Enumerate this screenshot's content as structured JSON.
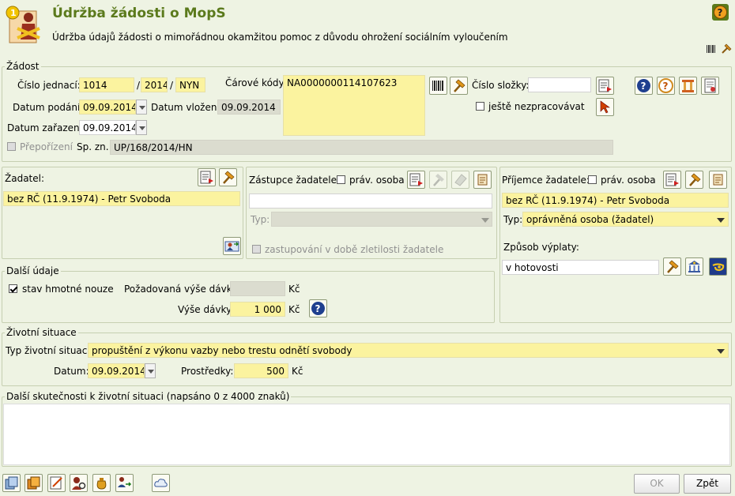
{
  "header": {
    "title": "Údržba žádosti o MopS",
    "subtitle": "Údržba údajů žádosti o mimořádnou okamžitou pomoc z důvodu ohrožení sociálním vyloučením",
    "help_icon": "help-icon",
    "tool_icons": [
      "barcode-icon",
      "hammer-icon"
    ]
  },
  "zadost": {
    "legend": "Žádost",
    "cislo_jednaci_label": "Číslo jednací:",
    "cj_1": "1014",
    "sep1": "/",
    "cj_2": "2014",
    "sep2": "/",
    "cj_3": "NYN",
    "carove_kody_label": "Čárové kódy:",
    "carove_kody_value": "NA0000000114107623",
    "cislo_slozky_label": "Číslo složky:",
    "cislo_slozky_value": "",
    "jeste_nezpracovavat_label": "ještě nezpracovávat",
    "datum_podani_label": "Datum podání:",
    "datum_podani": "09.09.2014",
    "datum_vlozeni_label": "Datum vložení:",
    "datum_vlozeni": "09.09.2014",
    "datum_zarazeni_label": "Datum zařazení:",
    "datum_zarazeni": "09.09.2014",
    "prepotizeni_label": "Přepořízení",
    "sp_zn_label": "Sp. zn.:",
    "sp_zn": "UP/168/2014/HN"
  },
  "zadatel": {
    "label": "Žadatel:",
    "value": "bez RČ (11.9.1974) - Petr Svoboda"
  },
  "zastupce": {
    "label": "Zástupce žadatele:",
    "prav_osoba": "práv. osoba",
    "value": "",
    "typ_label": "Typ:",
    "typ_value": "",
    "zletilost_label": "zastupování v době zletilosti žadatele"
  },
  "prijemce": {
    "label": "Příjemce žadatele:",
    "prav_osoba": "práv. osoba",
    "value": "bez RČ (11.9.1974) - Petr Svoboda",
    "typ_label": "Typ:",
    "typ_value": "oprávněná osoba (žadatel)",
    "zpusob_label": "Způsob výplaty:",
    "zpusob_value": "v hotovosti"
  },
  "dalsi": {
    "legend": "Další údaje",
    "hmotna_nouze": "stav hmotné nouze",
    "pozadovana_label": "Požadovaná výše dávky:",
    "pozadovana_value": "",
    "kc1": "Kč",
    "vyse_label": "Výše dávky:",
    "vyse_value": "1 000",
    "kc2": "Kč"
  },
  "zivotni": {
    "legend": "Životní situace",
    "typ_label": "Typ životní situace:",
    "typ_value": "propuštění z výkonu vazby nebo trestu odnětí svobody",
    "datum_label": "Datum:",
    "datum_value": "09.09.2014",
    "prostredky_label": "Prostředky:",
    "prostredky_value": "500",
    "kc": "Kč"
  },
  "skutecnosti": {
    "legend": "Další skutečnosti k životní situaci (napsáno 0 z 4000 znaků)",
    "value": ""
  },
  "footer": {
    "ok": "OK",
    "zpet": "Zpět"
  },
  "colors": {
    "accent": "#5b7a1c",
    "field": "#fbf39f",
    "background": "#eef3e3"
  }
}
